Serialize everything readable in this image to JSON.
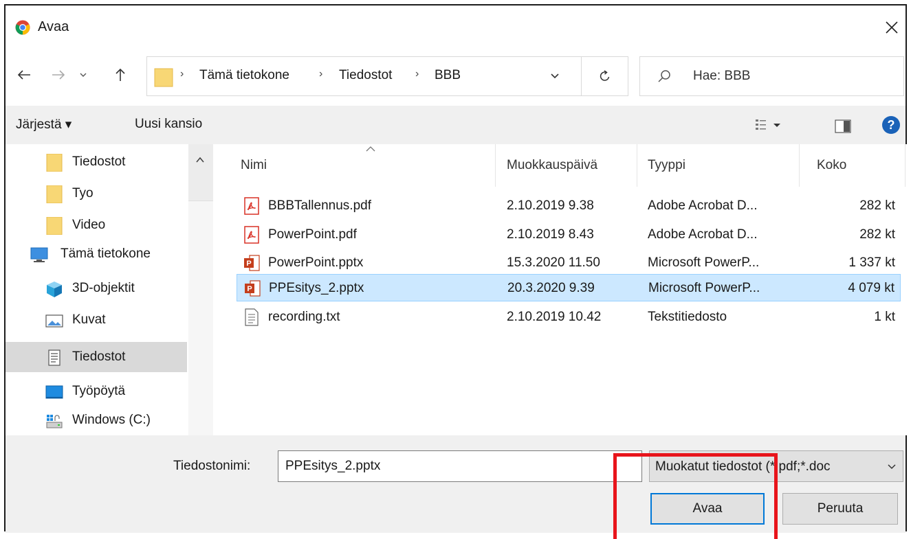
{
  "window": {
    "title": "Avaa",
    "app_icon": "chrome-icon"
  },
  "nav": {
    "breadcrumbs": [
      "Tämä tietokone",
      "Tiedostot",
      "BBB"
    ],
    "search_placeholder": "Hae: BBB"
  },
  "toolbar": {
    "organize_label": "Järjestä ▾",
    "new_folder_label": "Uusi kansio"
  },
  "sidebar": {
    "items": [
      {
        "label": "Tiedostot",
        "icon": "folder-icon"
      },
      {
        "label": "Tyo",
        "icon": "folder-icon"
      },
      {
        "label": "Video",
        "icon": "folder-icon"
      },
      {
        "label": "Tämä tietokone",
        "icon": "computer-icon"
      },
      {
        "label": "3D-objektit",
        "icon": "cube-3d-icon"
      },
      {
        "label": "Kuvat",
        "icon": "pictures-icon"
      },
      {
        "label": "Tiedostot",
        "icon": "documents-icon",
        "selected": true
      },
      {
        "label": "Työpöytä",
        "icon": "desktop-icon"
      },
      {
        "label": "Windows (C:)",
        "icon": "drive-icon"
      }
    ]
  },
  "columns": {
    "name": "Nimi",
    "modified": "Muokkauspäivä",
    "type": "Tyyppi",
    "size": "Koko"
  },
  "files": [
    {
      "name": "BBBTallennus.pdf",
      "modified": "2.10.2019 9.38",
      "type": "Adobe Acrobat D...",
      "size": "282 kt",
      "icon": "pdf-icon"
    },
    {
      "name": "PowerPoint.pdf",
      "modified": "2.10.2019 8.43",
      "type": "Adobe Acrobat D...",
      "size": "282 kt",
      "icon": "pdf-icon"
    },
    {
      "name": "PowerPoint.pptx",
      "modified": "15.3.2020 11.50",
      "type": "Microsoft PowerP...",
      "size": "1 337 kt",
      "icon": "pptx-icon"
    },
    {
      "name": "PPEsitys_2.pptx",
      "modified": "20.3.2020 9.39",
      "type": "Microsoft PowerP...",
      "size": "4 079 kt",
      "icon": "pptx-icon",
      "selected": true
    },
    {
      "name": "recording.txt",
      "modified": "2.10.2019 10.42",
      "type": "Tekstitiedosto",
      "size": "1 kt",
      "icon": "txt-icon"
    }
  ],
  "bottom": {
    "filename_label": "Tiedostonimi:",
    "filename_value": "PPEsitys_2.pptx",
    "filter_value": "Muokatut tiedostot (*.pdf;*.doc",
    "open_label": "Avaa",
    "cancel_label": "Peruuta"
  },
  "colors": {
    "accent": "#0078d7",
    "selection": "#cce8ff",
    "highlight": "#e8141b"
  }
}
